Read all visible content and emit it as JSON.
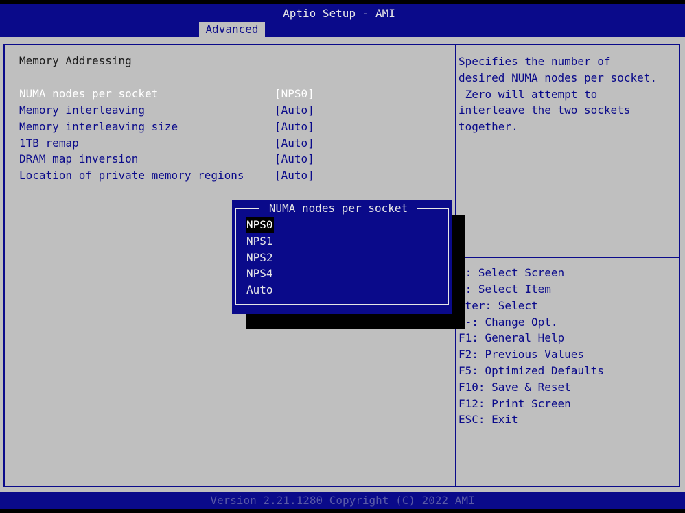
{
  "header": {
    "title": "Aptio Setup - AMI",
    "tabs": [
      {
        "label": "Advanced"
      }
    ]
  },
  "main": {
    "section_title": "Memory Addressing",
    "settings": [
      {
        "label": "NUMA nodes per socket",
        "value": "[NPS0]"
      },
      {
        "label": "Memory interleaving",
        "value": "[Auto]"
      },
      {
        "label": "Memory interleaving size",
        "value": "[Auto]"
      },
      {
        "label": "1TB remap",
        "value": "[Auto]"
      },
      {
        "label": "DRAM map inversion",
        "value": "[Auto]"
      },
      {
        "label": "Location of private memory regions",
        "value": "[Auto]"
      }
    ]
  },
  "help": {
    "lines": [
      "Specifies the number of",
      "desired NUMA nodes per socket.",
      " Zero will attempt to",
      "interleave the two sockets",
      "together."
    ]
  },
  "keys": {
    "lines": [
      "←: Select Screen",
      "↓: Select Item",
      "nter: Select",
      "/-: Change Opt.",
      "F1: General Help",
      "F2: Previous Values",
      "F5: Optimized Defaults",
      "F10: Save & Reset",
      "F12: Print Screen",
      "ESC: Exit"
    ]
  },
  "popup": {
    "title": "NUMA nodes per socket",
    "options": [
      "NPS0",
      "NPS1",
      "NPS2",
      "NPS4",
      "Auto"
    ],
    "selected": "NPS0"
  },
  "footer": {
    "version": "Version 2.21.1280 Copyright (C) 2022 AMI"
  },
  "colors": {
    "bios_blue": "#0a0a8a",
    "panel_gray": "#bfbfbf",
    "selected_text": "#ffffff",
    "shadow": "#000000"
  }
}
